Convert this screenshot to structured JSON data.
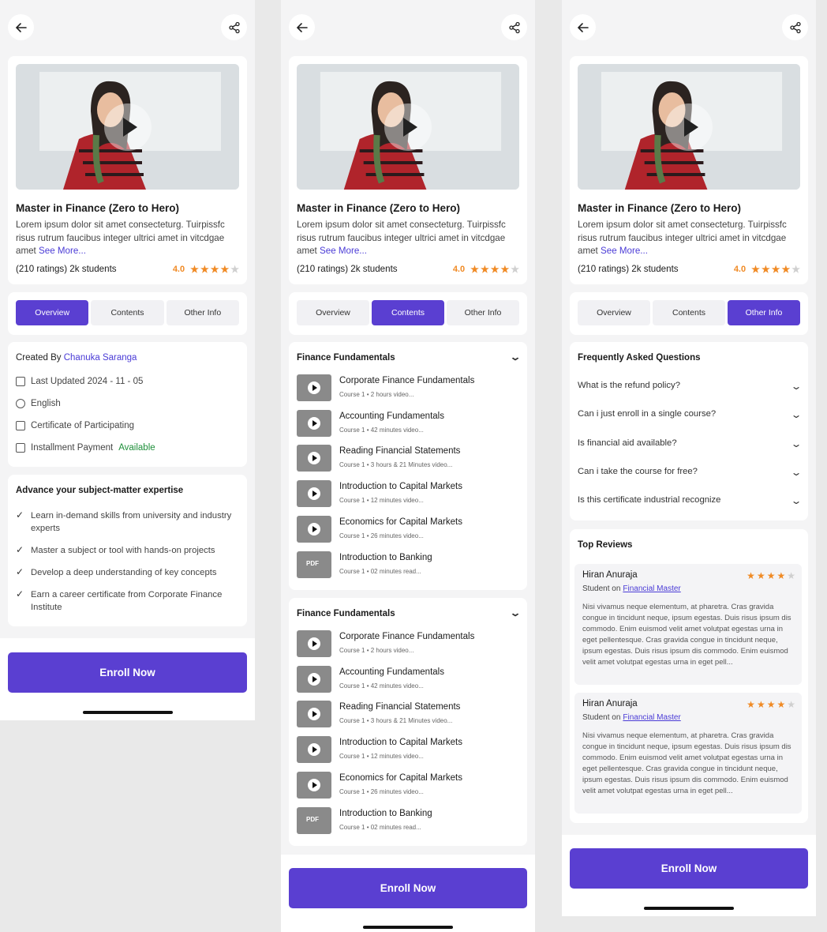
{
  "course": {
    "title": "Master in Finance (Zero to Hero)",
    "description": "Lorem ipsum dolor sit amet consecteturg. Tuirpissfc risus rutrum faucibus integer ultrici amet in vitcdgae amet",
    "see_more": "See More...",
    "stats": "(210 ratings) 2k students",
    "rating": "4.0",
    "stars": 4
  },
  "tabs": [
    "Overview",
    "Contents",
    "Other Info"
  ],
  "overview": {
    "created_by_label": "Created By",
    "author": "Chanuka Saranga",
    "last_updated": "Last Updated 2024 - 11 - 05",
    "language": "English",
    "certificate": "Certificate of Participating",
    "installment_label": "Installment  Payment",
    "installment_status": "Available",
    "learn_title": "Advance your subject-matter expertise",
    "learn_items": [
      "Learn in-demand skills from university and industry experts",
      "Master a subject or tool with hands-on projects",
      "Develop a deep understanding of key concepts",
      "Earn a career certificate from Corporate Finance Institute"
    ]
  },
  "contents": {
    "sections": [
      {
        "title": "Finance Fundamentals",
        "lessons": [
          {
            "title": "Corporate Finance Fundamentals",
            "course": "Course 1",
            "detail": "2 hours video...",
            "kind": "video"
          },
          {
            "title": "Accounting Fundamentals",
            "course": "Course 1",
            "detail": "42 minutes video...",
            "kind": "video"
          },
          {
            "title": "Reading Financial Statements",
            "course": "Course 1",
            "detail": "3 hours & 21 Minutes video...",
            "kind": "video"
          },
          {
            "title": "Introduction to Capital Markets",
            "course": "Course 1",
            "detail": "12 minutes video...",
            "kind": "video"
          },
          {
            "title": "Economics for Capital Markets",
            "course": "Course 1",
            "detail": "26 minutes video...",
            "kind": "video"
          },
          {
            "title": "Introduction to Banking",
            "course": "Course 1",
            "detail": "02 minutes read...",
            "kind": "pdf"
          }
        ]
      },
      {
        "title": "Finance Fundamentals",
        "lessons": [
          {
            "title": "Corporate Finance Fundamentals",
            "course": "Course 1",
            "detail": "2 hours video...",
            "kind": "video"
          },
          {
            "title": "Accounting Fundamentals",
            "course": "Course 1",
            "detail": "42 minutes video...",
            "kind": "video"
          },
          {
            "title": "Reading Financial Statements",
            "course": "Course 1",
            "detail": "3 hours & 21 Minutes video...",
            "kind": "video"
          },
          {
            "title": "Introduction to Capital Markets",
            "course": "Course 1",
            "detail": "12 minutes video...",
            "kind": "video"
          },
          {
            "title": "Economics for Capital Markets",
            "course": "Course 1",
            "detail": "26 minutes video...",
            "kind": "video"
          },
          {
            "title": "Introduction to Banking",
            "course": "Course 1",
            "detail": "02 minutes read...",
            "kind": "pdf"
          }
        ]
      }
    ]
  },
  "other_info": {
    "faq_title": "Frequently Asked Questions",
    "faqs": [
      "What is the refund policy?",
      "Can i just enroll in a single course?",
      "Is financial aid available?",
      "Can i take the course for free?",
      "Is this certificate industrial recognize"
    ],
    "reviews_title": "Top Reviews",
    "reviews": [
      {
        "name": "Hiran Anuraja",
        "role": "Student on",
        "program": "Financial Master",
        "stars": 4,
        "text": "Nisi vivamus neque elementum, at pharetra. Cras gravida congue in tincidunt neque, ipsum egestas. Duis risus ipsum dis commodo. Enim euismod velit amet volutpat egestas urna in eget pellentesque. Cras gravida congue in tincidunt neque, ipsum egestas. Duis risus ipsum dis commodo. Enim euismod velit amet volutpat egestas urna in eget pell..."
      },
      {
        "name": "Hiran Anuraja",
        "role": "Student on",
        "program": "Financial Master",
        "stars": 4,
        "text": "Nisi vivamus neque elementum, at pharetra. Cras gravida congue in tincidunt neque, ipsum egestas. Duis risus ipsum dis commodo. Enim euismod velit amet volutpat egestas urna in eget pellentesque. Cras gravida congue in tincidunt neque, ipsum egestas. Duis risus ipsum dis commodo. Enim euismod velit amet volutpat egestas urna in eget pell..."
      }
    ]
  },
  "enroll_label": "Enroll Now",
  "colors": {
    "accent": "#5a3fd1",
    "star": "#f08a24",
    "available": "#1e8f3a"
  },
  "icons": {
    "back": "arrow-left-icon",
    "share": "share-icon",
    "play": "play-icon",
    "chevron": "chevron-down-icon"
  }
}
